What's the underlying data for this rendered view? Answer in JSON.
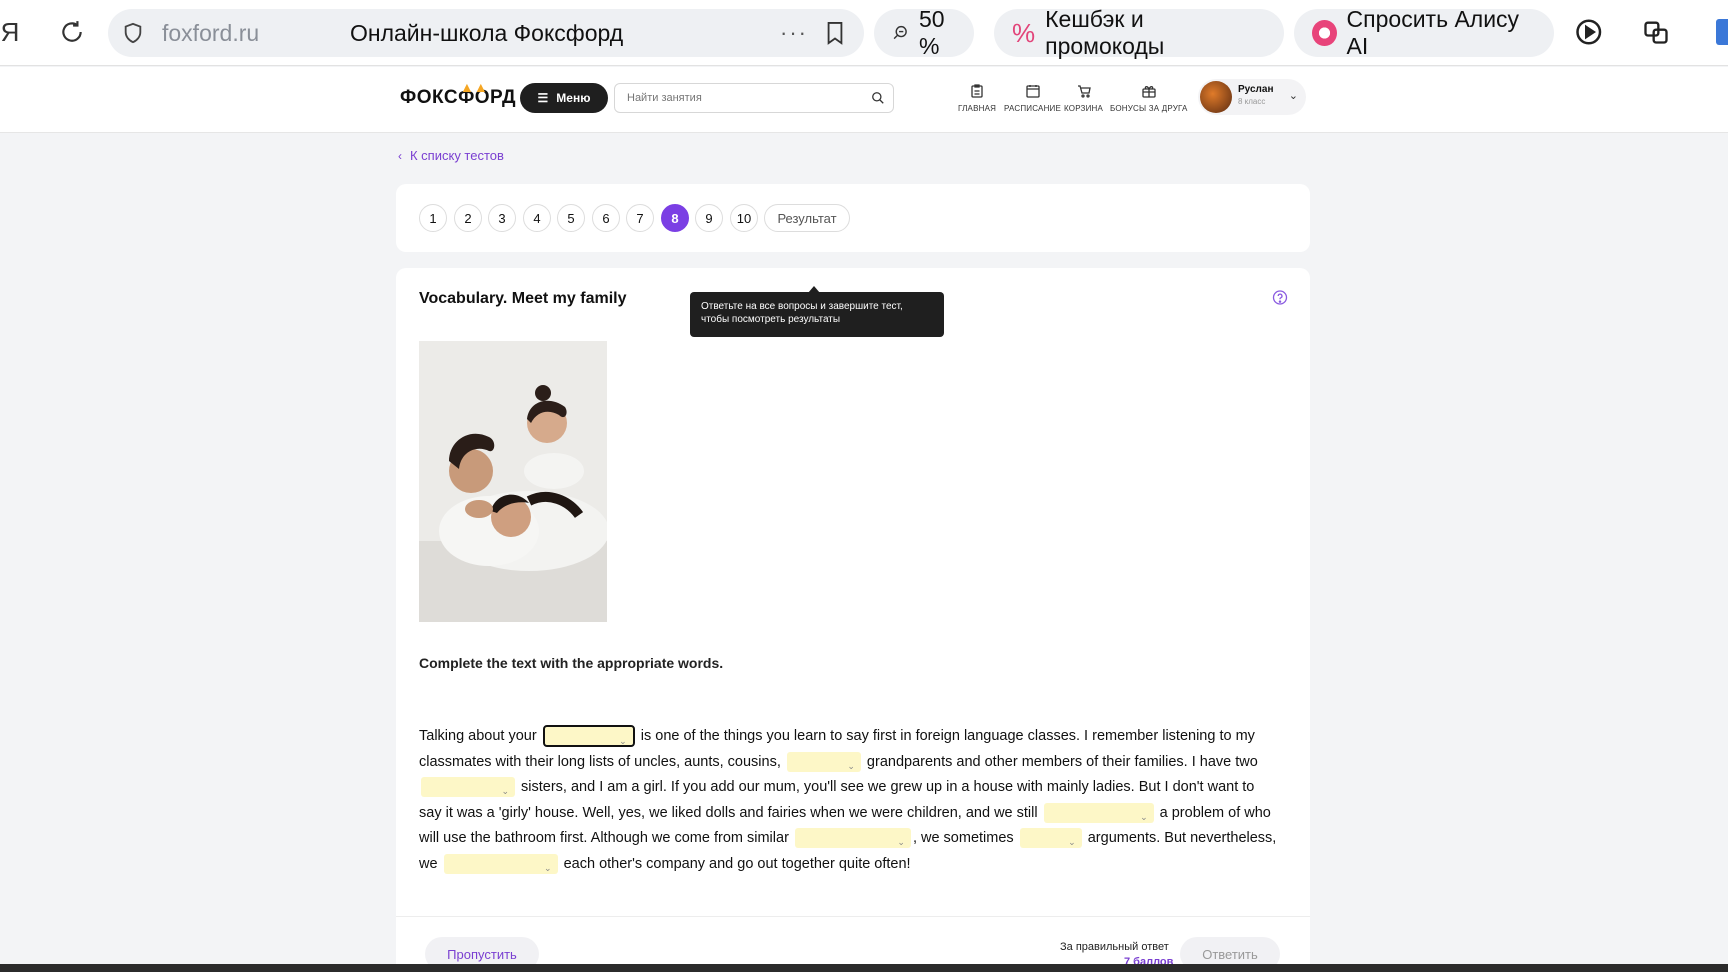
{
  "browser": {
    "logo_glyph": "Я",
    "domain": "foxford.ru",
    "tab_title": "Онлайн-школа Фоксфорд",
    "more_glyph": "···",
    "zoom": "50 %",
    "cashback": "Кешбэк и промокоды",
    "alice": "Спросить Алису AI"
  },
  "header": {
    "logo_text": "ФОКСФОРД",
    "menu_label": "Меню",
    "search_placeholder": "Найти занятия",
    "nav": [
      {
        "label": "ГЛАВНАЯ",
        "icon": "clipboard-icon"
      },
      {
        "label": "РАСПИСАНИЕ",
        "icon": "calendar-icon"
      },
      {
        "label": "КОРЗИНА",
        "icon": "cart-icon"
      },
      {
        "label": "БОНУСЫ ЗА ДРУГА",
        "icon": "gift-icon"
      }
    ],
    "user": {
      "name": "Руслан",
      "grade": "8 класс"
    }
  },
  "back_link": "К списку тестов",
  "pager": {
    "pages": [
      "1",
      "2",
      "3",
      "4",
      "5",
      "6",
      "7",
      "8",
      "9",
      "10"
    ],
    "active": "8",
    "result_label": "Результат"
  },
  "question": {
    "title": "Vocabulary. Meet my family",
    "tooltip": "Ответьте на все вопросы и завершите тест, чтобы посмотреть результаты",
    "instruction": "Complete the text with the appropriate words.",
    "passage": {
      "t1": "Talking about your",
      "t2": "is one of the things you learn to say first in foreign language classes. I remember listening to my classmates with their long lists of uncles, aunts, cousins,",
      "t3": "grandparents and other members of their families. I have two",
      "t4": "sisters, and I am a girl. If you add our mum, you'll see we grew up in a house with mainly ladies. But I don't want to say it was a 'girly' house. Well, yes, we liked dolls and fairies when we were children, and we still",
      "t5": "a problem of who will use the bathroom first. Although we come from similar",
      "t6": ", we sometimes",
      "t7": "arguments. But nevertheless, we",
      "t8": "each other's company and go out together quite often!"
    }
  },
  "footer": {
    "skip_label": "Пропустить",
    "points_label": "За правильный ответ",
    "points_value": "7 баллов",
    "answer_label": "Ответить"
  }
}
